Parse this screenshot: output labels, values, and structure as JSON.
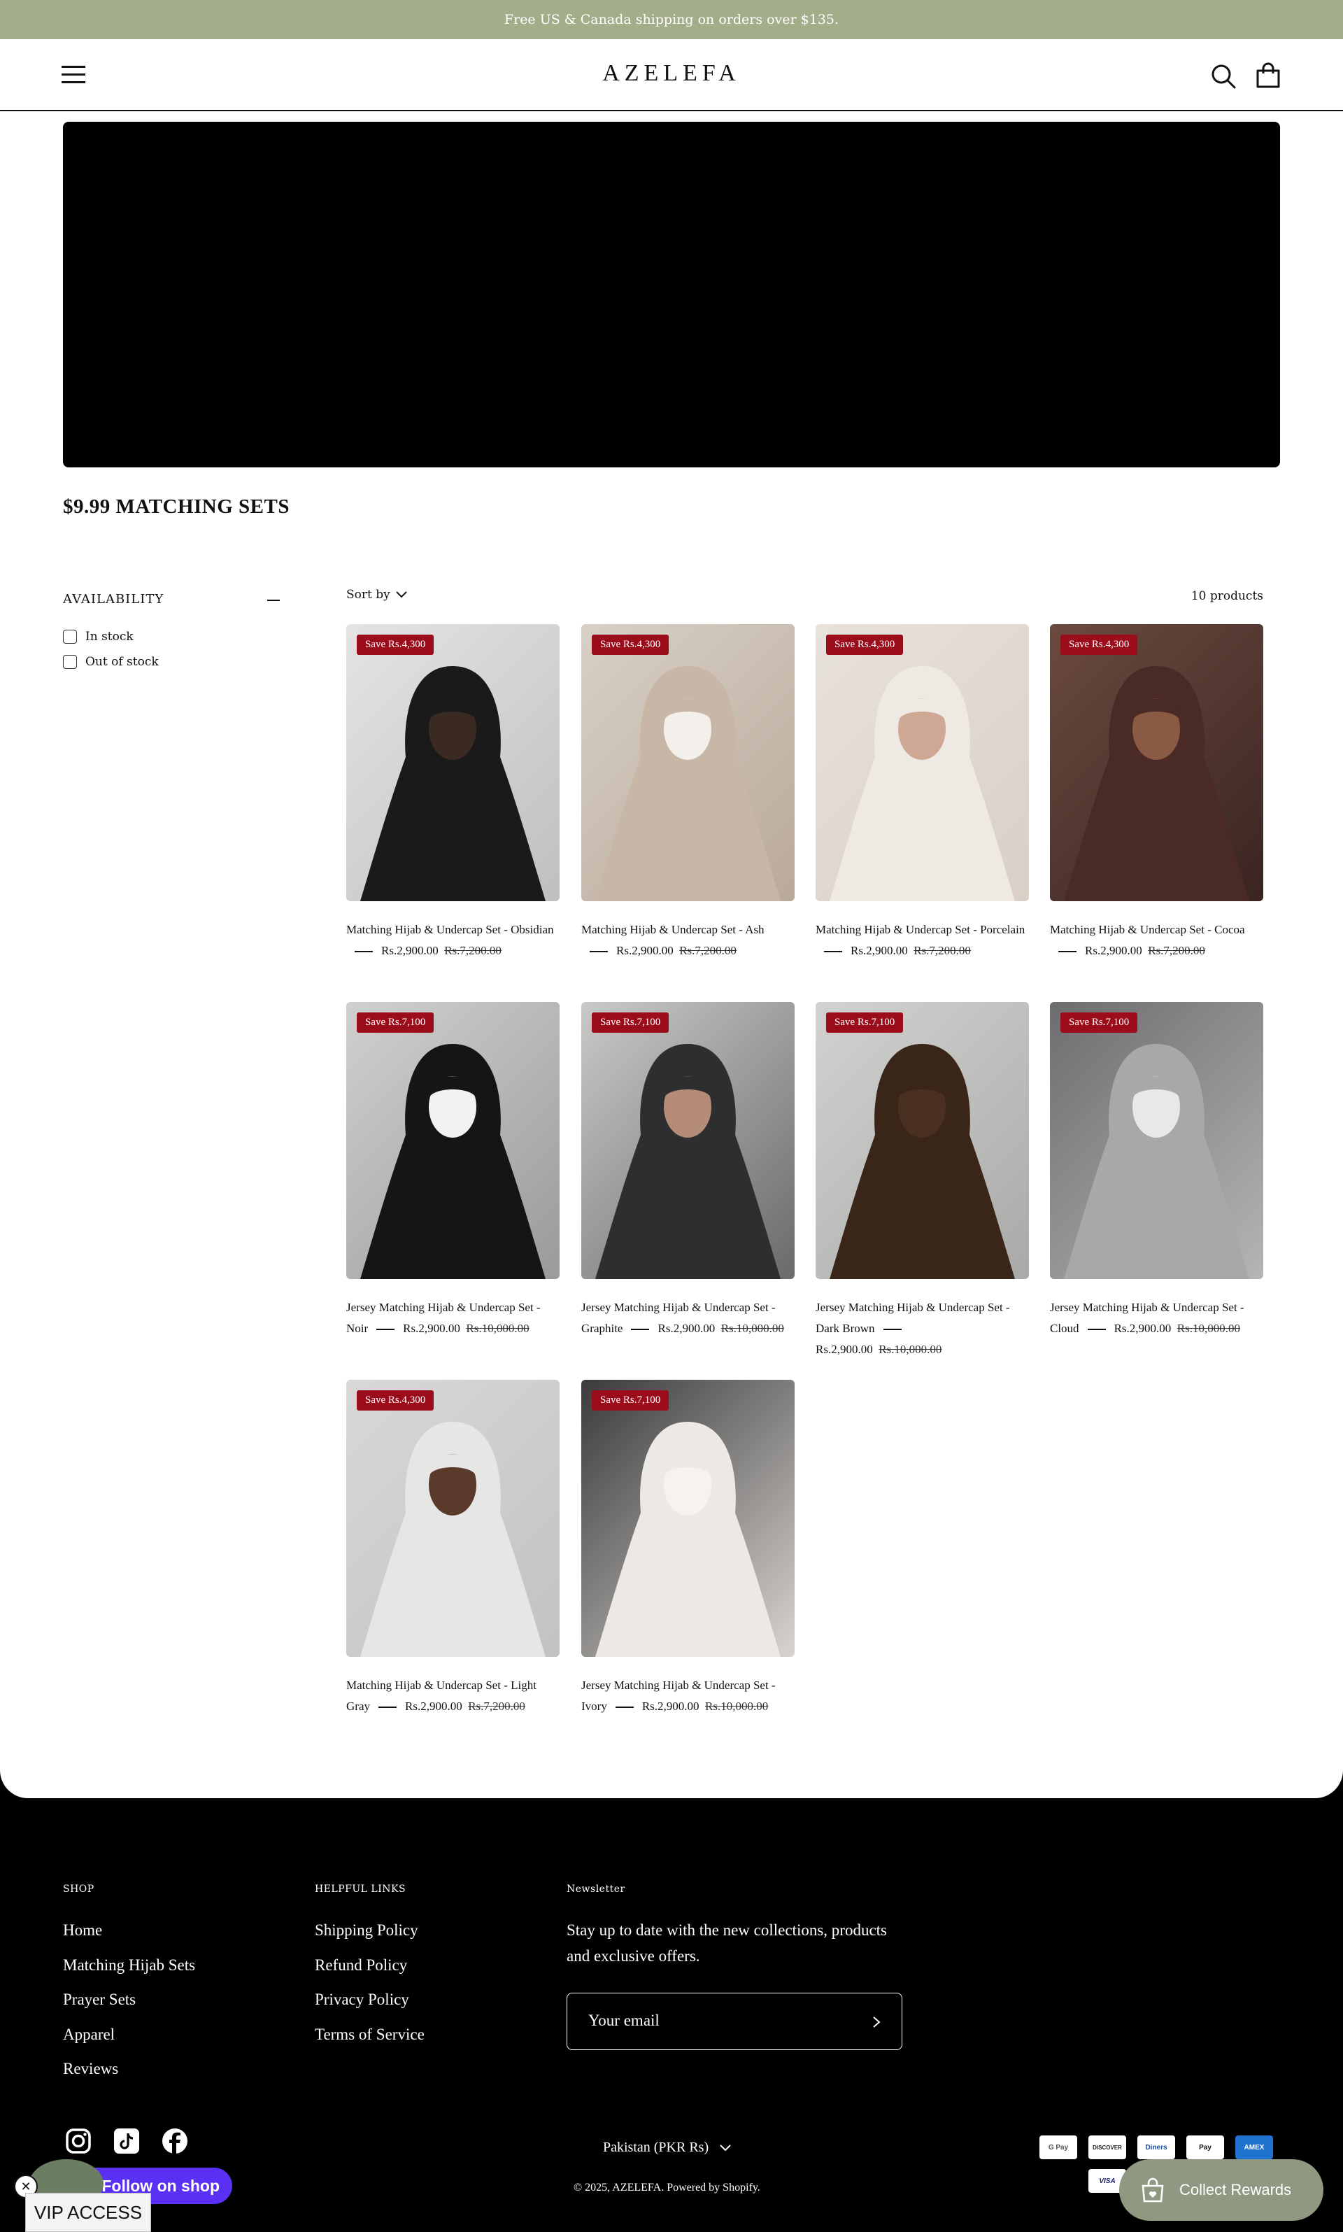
{
  "announcement": "Free US & Canada shipping on orders over $135.",
  "header": {
    "logo": "AZELEFA",
    "icons": [
      "menu-icon",
      "search-icon",
      "cart-icon"
    ]
  },
  "collection": {
    "title": "$9.99 MATCHING SETS"
  },
  "filters": {
    "title": "AVAILABILITY",
    "options": [
      {
        "label": "In stock",
        "checked": false
      },
      {
        "label": "Out of stock",
        "checked": false
      }
    ]
  },
  "toolbar": {
    "sort_label": "Sort by",
    "count": "10 products"
  },
  "products": [
    {
      "badge": "Save Rs.4,300",
      "title": "Matching Hijab & Undercap Set - Obsidian",
      "price": "Rs.2,900.00",
      "compare": "Rs.7,200.00",
      "img": [
        "#e4e4e2",
        "#bfbfbd",
        "#1a1a1a",
        "#3b2a22"
      ]
    },
    {
      "badge": "Save Rs.4,300",
      "title": "Matching Hijab & Undercap Set - Ash",
      "price": "Rs.2,900.00",
      "compare": "Rs.7,200.00",
      "img": [
        "#d8d0c6",
        "#b9a99a",
        "#c8b7a6",
        "#f3efea"
      ]
    },
    {
      "badge": "Save Rs.4,300",
      "title": "Matching Hijab & Undercap Set - Porcelain",
      "price": "Rs.2,900.00",
      "compare": "Rs.7,200.00",
      "img": [
        "#e8e2dc",
        "#d9cfc6",
        "#efe9e3",
        "#cfa895"
      ]
    },
    {
      "badge": "Save Rs.4,300",
      "title": "Matching Hijab & Undercap Set - Cocoa",
      "price": "Rs.2,900.00",
      "compare": "Rs.7,200.00",
      "img": [
        "#6b4a40",
        "#3a2420",
        "#4a2a24",
        "#8b5a45"
      ]
    },
    {
      "badge": "Save Rs.7,100",
      "title": "Jersey Matching Hijab & Undercap Set - Noir",
      "price": "Rs.2,900.00",
      "compare": "Rs.10,000.00",
      "img": [
        "#d0d0ce",
        "#9a9a98",
        "#151515",
        "#f2f2f0"
      ]
    },
    {
      "badge": "Save Rs.7,100",
      "title": "Jersey Matching Hijab & Undercap Set - Graphite",
      "price": "Rs.2,900.00",
      "compare": "Rs.10,000.00",
      "img": [
        "#c9c9c7",
        "#6a6a6a",
        "#2e2e30",
        "#b48c78"
      ]
    },
    {
      "badge": "Save Rs.7,100",
      "title": "Jersey Matching Hijab & Undercap Set - Dark Brown",
      "price": "Rs.2,900.00",
      "compare": "Rs.10,000.00",
      "img": [
        "#d2d2d0",
        "#a9a9a7",
        "#3a2618",
        "#4a3020"
      ]
    },
    {
      "badge": "Save Rs.7,100",
      "title": "Jersey Matching Hijab & Undercap Set - Cloud",
      "price": "Rs.2,900.00",
      "compare": "Rs.10,000.00",
      "img": [
        "#6d6d6f",
        "#b5b5b7",
        "#a8a8aa",
        "#e8e8e6"
      ]
    },
    {
      "badge": "Save Rs.4,300",
      "title": "Matching Hijab & Undercap Set - Light Gray",
      "price": "Rs.2,900.00",
      "compare": "Rs.7,200.00",
      "img": [
        "#d8d8d6",
        "#c2c2c0",
        "#e6e6e4",
        "#5a3a2a"
      ]
    },
    {
      "badge": "Save Rs.7,100",
      "title": "Jersey Matching Hijab & Undercap Set - Ivory",
      "price": "Rs.2,900.00",
      "compare": "Rs.10,000.00",
      "img": [
        "#3a3a3c",
        "#d8d4cf",
        "#ece8e3",
        "#f6f3ef"
      ]
    }
  ],
  "footer": {
    "shop_title": "SHOP",
    "shop_links": [
      "Home",
      "Matching Hijab Sets",
      "Prayer Sets",
      "Apparel",
      "Reviews"
    ],
    "helpful_title": "HELPFUL LINKS",
    "helpful_links": [
      "Shipping Policy",
      "Refund Policy",
      "Privacy Policy",
      "Terms of Service"
    ],
    "newsletter_title": "Newsletter",
    "newsletter_text": "Stay up to date with the new collections, products and exclusive offers.",
    "email_placeholder": "Your email",
    "country": "Pakistan (PKR Rs)",
    "copyright": "© 2025, AZELEFA. Powered by Shopify.",
    "social_icons": [
      "instagram-icon",
      "tiktok-icon",
      "facebook-icon"
    ],
    "payments": [
      "G Pay",
      "DISCOVER",
      "Diners",
      "Pay",
      "AMEX",
      "VISA"
    ]
  },
  "widgets": {
    "rewards": "Collect Rewards",
    "follow": "Follow on shop",
    "vip": "VIP ACCESS",
    "close": "✕"
  },
  "colors": {
    "announcement_bg": "#a3ad89",
    "badge": "#9b0d1b",
    "rewards_bg": "#8f9880",
    "shop_purple": "#5a31f4"
  }
}
